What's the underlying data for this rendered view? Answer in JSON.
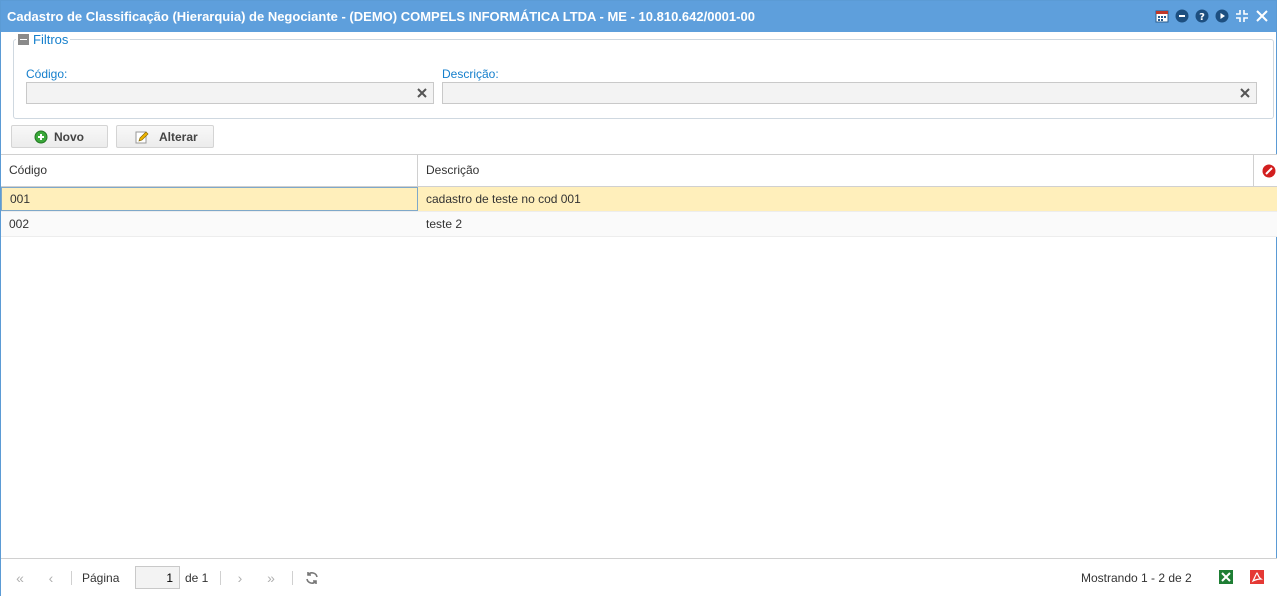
{
  "window": {
    "title": "Cadastro de Classificação (Hierarquia) de Negociante - (DEMO) COMPELS INFORMÁTICA LTDA - ME - 10.810.642/0001-00",
    "tools": [
      "calendar-icon",
      "minimize-icon",
      "help-icon",
      "play-icon",
      "collapse-icon",
      "close-icon"
    ]
  },
  "filters": {
    "legend": "Filtros",
    "codigo_label": "Código:",
    "codigo_value": "",
    "descricao_label": "Descrição:",
    "descricao_value": ""
  },
  "toolbar": {
    "novo_label": "Novo",
    "alterar_label": "Alterar"
  },
  "grid": {
    "columns": [
      "Código",
      "Descrição"
    ],
    "rows": [
      {
        "codigo": "001",
        "descricao": "cadastro de teste no cod 001",
        "selected": true
      },
      {
        "codigo": "002",
        "descricao": "teste 2",
        "selected": false
      }
    ]
  },
  "pager": {
    "page_label": "Página",
    "page_value": "1",
    "of_label": "de 1",
    "status": "Mostrando 1 - 2 de 2"
  },
  "colors": {
    "titlebar": "#5e9fdc",
    "accent": "#157fcc",
    "selected_row": "#ffefbb"
  }
}
